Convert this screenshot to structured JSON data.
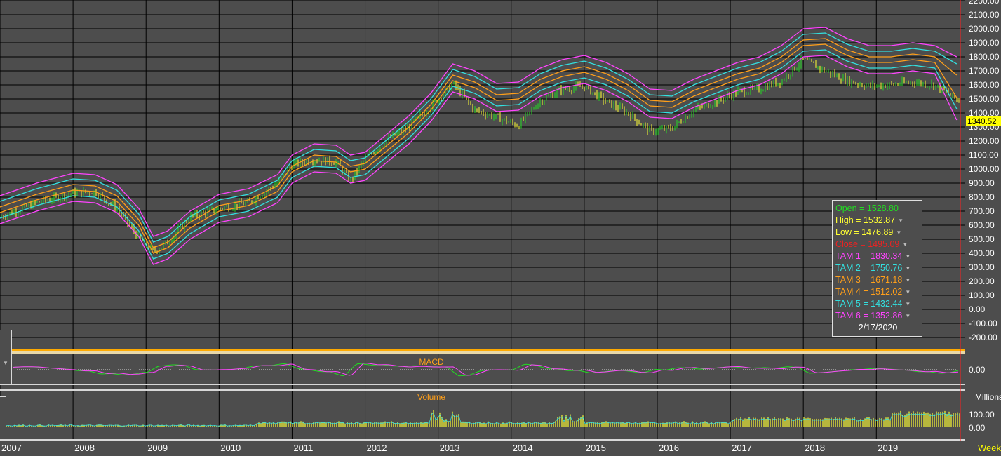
{
  "price_axis": {
    "ticks": [
      "2200.00",
      "2100.00",
      "2000.00",
      "1900.00",
      "1800.00",
      "1700.00",
      "1600.00",
      "1500.00",
      "1400.00",
      "1300.00",
      "1200.00",
      "1100.00",
      "1000.00",
      "900.00",
      "800.00",
      "700.00",
      "600.00",
      "500.00",
      "400.00",
      "300.00",
      "200.00",
      "100.00",
      "0.00",
      "-100.00",
      "-200.00"
    ],
    "last_price_tag": "1340.52"
  },
  "macd_panel": {
    "title": "MACD",
    "axis_tick": "0.00"
  },
  "volume_panel": {
    "title": "Volume",
    "unit": "Millions",
    "axis_ticks": [
      "100.00",
      "0.00"
    ]
  },
  "time_axis": {
    "labels": [
      "2007",
      "2008",
      "2009",
      "2010",
      "2011",
      "2012",
      "2013",
      "2014",
      "2015",
      "2016",
      "2017",
      "2018",
      "2019"
    ],
    "period": "Week"
  },
  "legend": {
    "rows": [
      {
        "label": "Open = 1528.80",
        "color": "#22dd22",
        "has_arrow": false
      },
      {
        "label": "High = 1532.87",
        "color": "#ffff33",
        "has_arrow": true
      },
      {
        "label": "Low = 1476.89",
        "color": "#ffff33",
        "has_arrow": true
      },
      {
        "label": "Close = 1495.09",
        "color": "#ee2222",
        "has_arrow": true
      },
      {
        "label": "TAM 1 = 1830.34",
        "color": "#ff44ff",
        "has_arrow": true
      },
      {
        "label": "TAM 2 = 1750.76",
        "color": "#33e0e0",
        "has_arrow": true
      },
      {
        "label": "TAM 3 = 1671.18",
        "color": "#ff9f1a",
        "has_arrow": true
      },
      {
        "label": "TAM 4 = 1512.02",
        "color": "#ff9f1a",
        "has_arrow": true
      },
      {
        "label": "TAM 5 = 1432.44",
        "color": "#33e0e0",
        "has_arrow": true
      },
      {
        "label": "TAM 6 = 1352.86",
        "color": "#ff44ff",
        "has_arrow": true
      }
    ],
    "date": "2/17/2020"
  },
  "colors": {
    "background": "#4d4d4d",
    "grid": "#000000",
    "candle_up": "#22dd22",
    "candle_down": "#ffff33",
    "band_outer": "#ff44ff",
    "band_mid": "#33e0e0",
    "band_inner": "#ff9f1a",
    "volume": "#ffff33",
    "volume_avg": "#33e0e0",
    "panel_title": "#ff9f1a",
    "current_line": "#ff2020",
    "price_tag_bg": "#ffff00"
  },
  "chart_data": {
    "type": "line",
    "x": [
      2007.0,
      2007.5,
      2008.0,
      2008.3,
      2008.6,
      2008.9,
      2009.1,
      2009.3,
      2009.6,
      2010.0,
      2010.4,
      2010.8,
      2011.0,
      2011.3,
      2011.6,
      2011.8,
      2012.0,
      2012.3,
      2012.6,
      2012.9,
      2013.2,
      2013.5,
      2013.8,
      2014.1,
      2014.4,
      2014.7,
      2015.0,
      2015.3,
      2015.6,
      2015.9,
      2016.2,
      2016.5,
      2016.8,
      2017.1,
      2017.4,
      2017.7,
      2018.0,
      2018.3,
      2018.6,
      2018.9,
      2019.2,
      2019.5,
      2019.8,
      2020.1
    ],
    "series": [
      {
        "name": "Close",
        "values": [
          660,
          760,
          830,
          840,
          720,
          510,
          410,
          480,
          660,
          720,
          760,
          900,
          1030,
          1070,
          1050,
          920,
          1070,
          1210,
          1300,
          1450,
          1610,
          1420,
          1370,
          1310,
          1490,
          1570,
          1590,
          1480,
          1400,
          1270,
          1290,
          1420,
          1480,
          1550,
          1570,
          1630,
          1780,
          1700,
          1630,
          1590,
          1600,
          1620,
          1600,
          1495
        ]
      },
      {
        "name": "TAM 1",
        "values": [
          810,
          900,
          970,
          960,
          890,
          720,
          520,
          560,
          700,
          820,
          860,
          960,
          1100,
          1180,
          1170,
          1100,
          1120,
          1250,
          1380,
          1540,
          1750,
          1700,
          1610,
          1620,
          1720,
          1780,
          1810,
          1760,
          1680,
          1570,
          1560,
          1640,
          1700,
          1760,
          1800,
          1880,
          2000,
          2010,
          1930,
          1880,
          1880,
          1900,
          1880,
          1800
        ]
      },
      {
        "name": "TAM 2",
        "values": [
          770,
          860,
          930,
          920,
          850,
          680,
          480,
          520,
          660,
          780,
          820,
          920,
          1060,
          1140,
          1130,
          1060,
          1080,
          1210,
          1340,
          1500,
          1710,
          1660,
          1570,
          1580,
          1680,
          1740,
          1770,
          1720,
          1640,
          1530,
          1520,
          1600,
          1660,
          1720,
          1760,
          1840,
          1960,
          1970,
          1890,
          1840,
          1840,
          1860,
          1840,
          1750
        ]
      },
      {
        "name": "TAM 3",
        "values": [
          730,
          820,
          890,
          880,
          810,
          640,
          440,
          480,
          620,
          740,
          780,
          880,
          1020,
          1100,
          1090,
          1020,
          1040,
          1170,
          1300,
          1460,
          1670,
          1620,
          1530,
          1540,
          1640,
          1700,
          1730,
          1680,
          1600,
          1490,
          1480,
          1560,
          1620,
          1680,
          1720,
          1800,
          1920,
          1930,
          1850,
          1800,
          1800,
          1820,
          1800,
          1670
        ]
      },
      {
        "name": "TAM 4",
        "values": [
          690,
          780,
          850,
          840,
          770,
          600,
          400,
          440,
          580,
          700,
          740,
          840,
          980,
          1060,
          1050,
          980,
          1000,
          1130,
          1260,
          1420,
          1630,
          1580,
          1490,
          1500,
          1600,
          1660,
          1690,
          1640,
          1560,
          1450,
          1440,
          1520,
          1580,
          1640,
          1680,
          1760,
          1880,
          1890,
          1810,
          1760,
          1760,
          1780,
          1760,
          1510
        ]
      },
      {
        "name": "TAM 5",
        "values": [
          650,
          740,
          810,
          800,
          730,
          560,
          360,
          400,
          540,
          660,
          700,
          800,
          940,
          1020,
          1010,
          940,
          960,
          1090,
          1220,
          1380,
          1590,
          1540,
          1450,
          1460,
          1560,
          1620,
          1650,
          1600,
          1520,
          1410,
          1400,
          1480,
          1540,
          1600,
          1640,
          1720,
          1840,
          1850,
          1770,
          1720,
          1720,
          1740,
          1720,
          1430
        ]
      },
      {
        "name": "TAM 6",
        "values": [
          610,
          700,
          770,
          760,
          690,
          520,
          320,
          360,
          500,
          620,
          660,
          760,
          900,
          980,
          970,
          900,
          920,
          1050,
          1180,
          1340,
          1550,
          1500,
          1410,
          1420,
          1520,
          1580,
          1610,
          1560,
          1480,
          1370,
          1360,
          1440,
          1500,
          1560,
          1600,
          1680,
          1800,
          1810,
          1730,
          1680,
          1680,
          1700,
          1680,
          1350
        ]
      }
    ],
    "xlabel": "",
    "ylabel": "",
    "ylim": [
      -200,
      2200
    ],
    "grid": true,
    "legend_position": "right"
  }
}
